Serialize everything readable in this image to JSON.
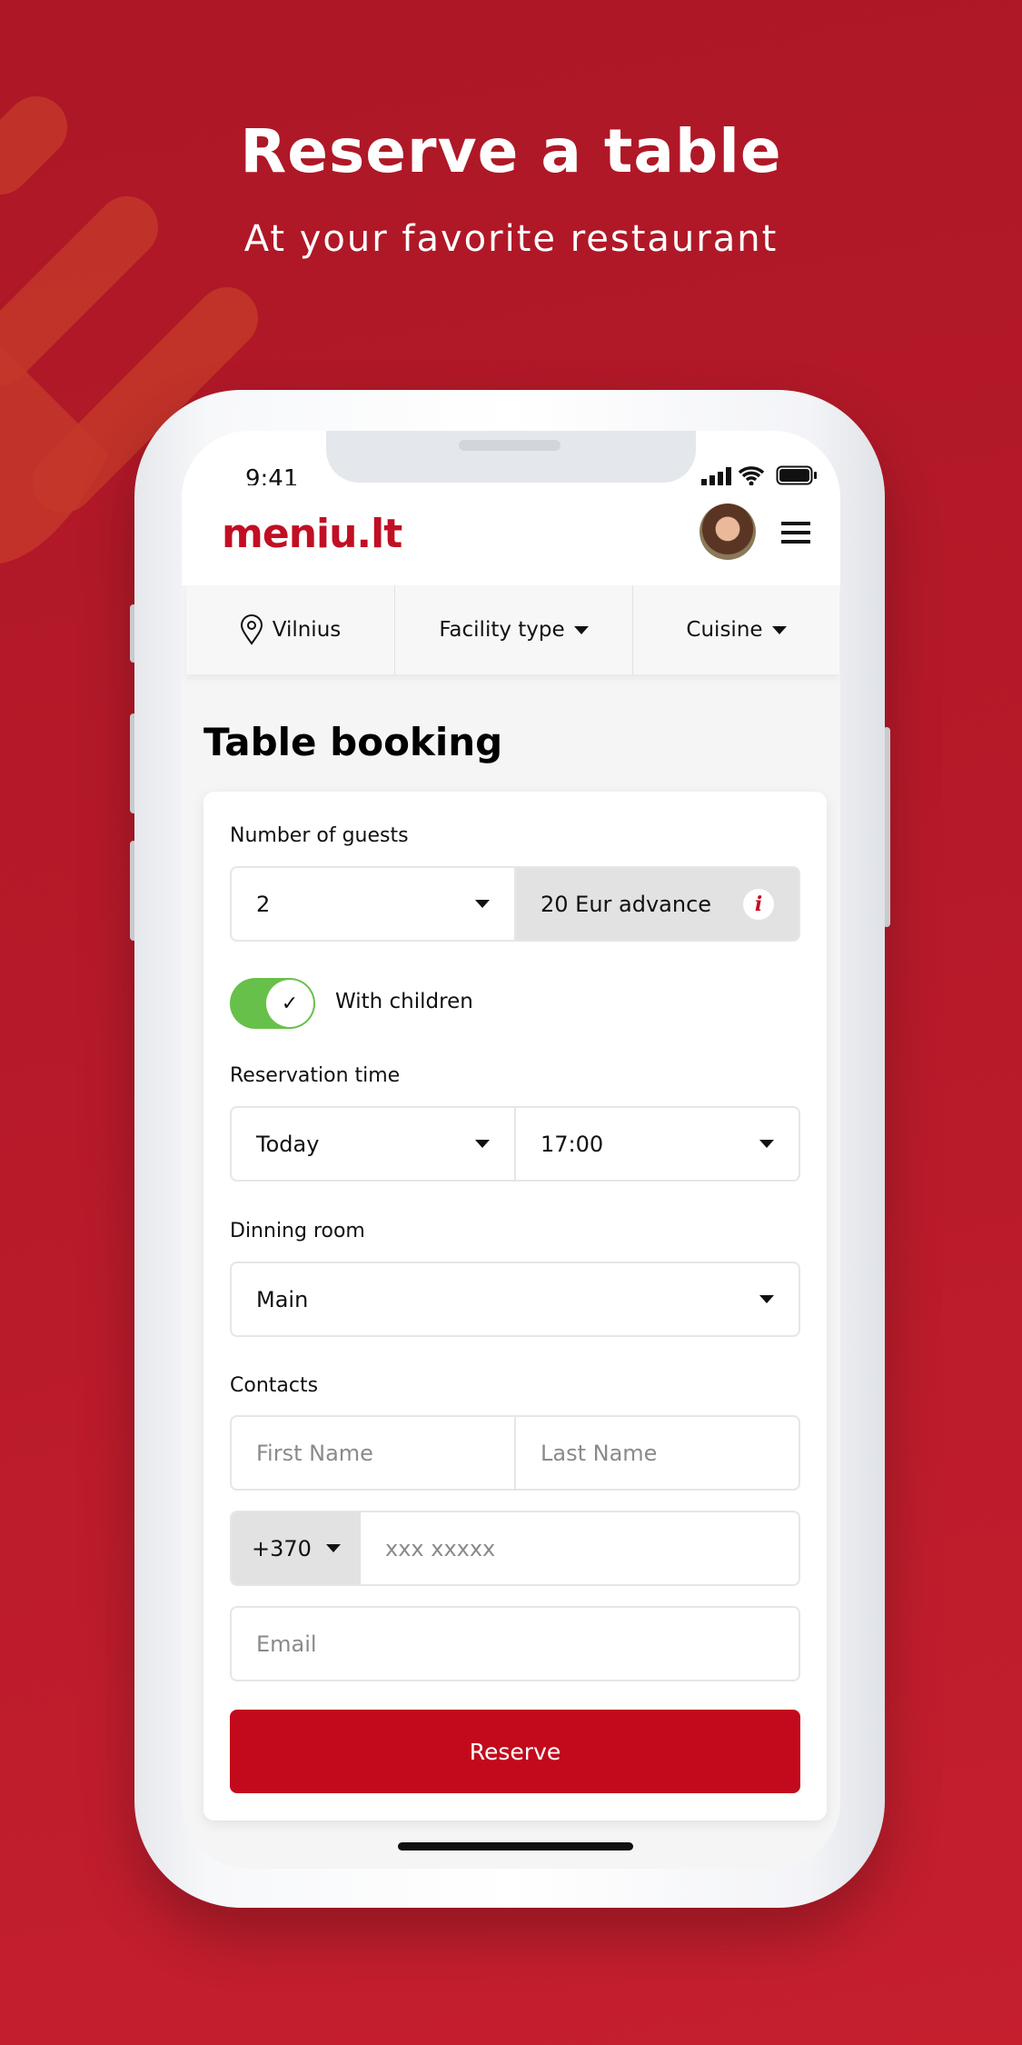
{
  "hero": {
    "title": "Reserve a table",
    "subtitle": "At your favorite restaurant"
  },
  "status": {
    "time": "9:41"
  },
  "header": {
    "logo": "meniu.lt"
  },
  "filters": {
    "city": "Vilnius",
    "facility": "Facility type",
    "cuisine": "Cuisine"
  },
  "page": {
    "title": "Table booking"
  },
  "form": {
    "guests_label": "Number of guests",
    "guests_value": "2",
    "advance": "20 Eur advance",
    "children_label": "With children",
    "children_on": true,
    "time_label": "Reservation time",
    "day_value": "Today",
    "time_value": "17:00",
    "room_label": "Dinning room",
    "room_value": "Main",
    "contacts_label": "Contacts",
    "first_name_placeholder": "First Name",
    "last_name_placeholder": "Last Name",
    "phone_prefix": "+370",
    "phone_placeholder": "xxx xxxxx",
    "email_placeholder": "Email",
    "submit": "Reserve"
  },
  "colors": {
    "brand": "#c20a1c",
    "toggle": "#67c04a"
  }
}
